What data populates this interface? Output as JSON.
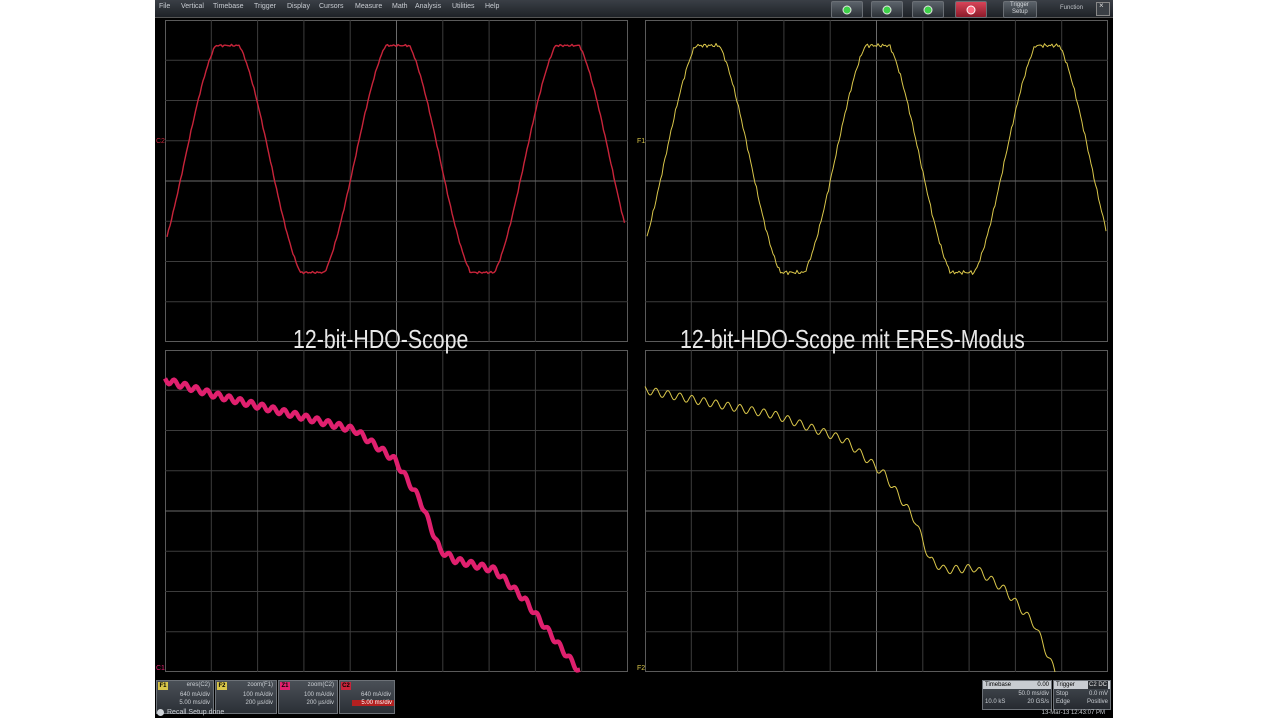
{
  "menu": [
    "File",
    "Vertical",
    "Timebase",
    "Trigger",
    "Display",
    "Cursors",
    "Measure",
    "Math",
    "Analysis",
    "Utilities",
    "Help"
  ],
  "toolbar": {
    "trigger_setup_line1": "Trigger",
    "trigger_setup_line2": "Setup",
    "function_label": "Function",
    "colors": {
      "green": "#3fd24a",
      "red": "#e8324a"
    }
  },
  "panels": {
    "top_left_label": "12-bit-HDO-Scope",
    "top_right_label": "12-bit-HDO-Scope mit ERES-Modus",
    "axis_marks": {
      "c1": "C1",
      "c2": "C2",
      "f1": "F1",
      "f2": "F2"
    }
  },
  "traces": {
    "colors": {
      "red_sine": "#c8243a",
      "yellow": "#d9c64a",
      "magenta": "#e0206e"
    }
  },
  "channels": [
    {
      "badge": "F1",
      "badge_color": "#d9c64a",
      "name": "eres(C2)",
      "scale": "640 mA/div",
      "timebase": "5.00 ms/div",
      "selected": false
    },
    {
      "badge": "F2",
      "badge_color": "#d9c64a",
      "name": "zoom(F1)",
      "scale": "100 mA/div",
      "timebase": "200 µs/div",
      "selected": false
    },
    {
      "badge": "Z1",
      "badge_color": "#e0206e",
      "name": "zoom(C2)",
      "scale": "100 mA/div",
      "timebase": "200 µs/div",
      "selected": false
    },
    {
      "badge": "C2",
      "badge_color": "#c8243a",
      "name": "",
      "scale": "640 mA/div",
      "timebase": "5.00 ms/div",
      "selected": true
    }
  ],
  "timebase": {
    "title": "Timebase",
    "delay": "0.00",
    "rows": [
      [
        "",
        "50.0 ms/div"
      ],
      [
        "10.0 kS",
        "20 GS/s"
      ]
    ]
  },
  "trigger": {
    "title": "Trigger",
    "channel": "C2 DC",
    "rows": [
      [
        "Stop",
        "0.0 mV"
      ],
      [
        "Edge",
        "Positive"
      ]
    ]
  },
  "status": {
    "message": "Recall Setup done",
    "datetime": "13-Mar-13  12:43:07 PM"
  }
}
